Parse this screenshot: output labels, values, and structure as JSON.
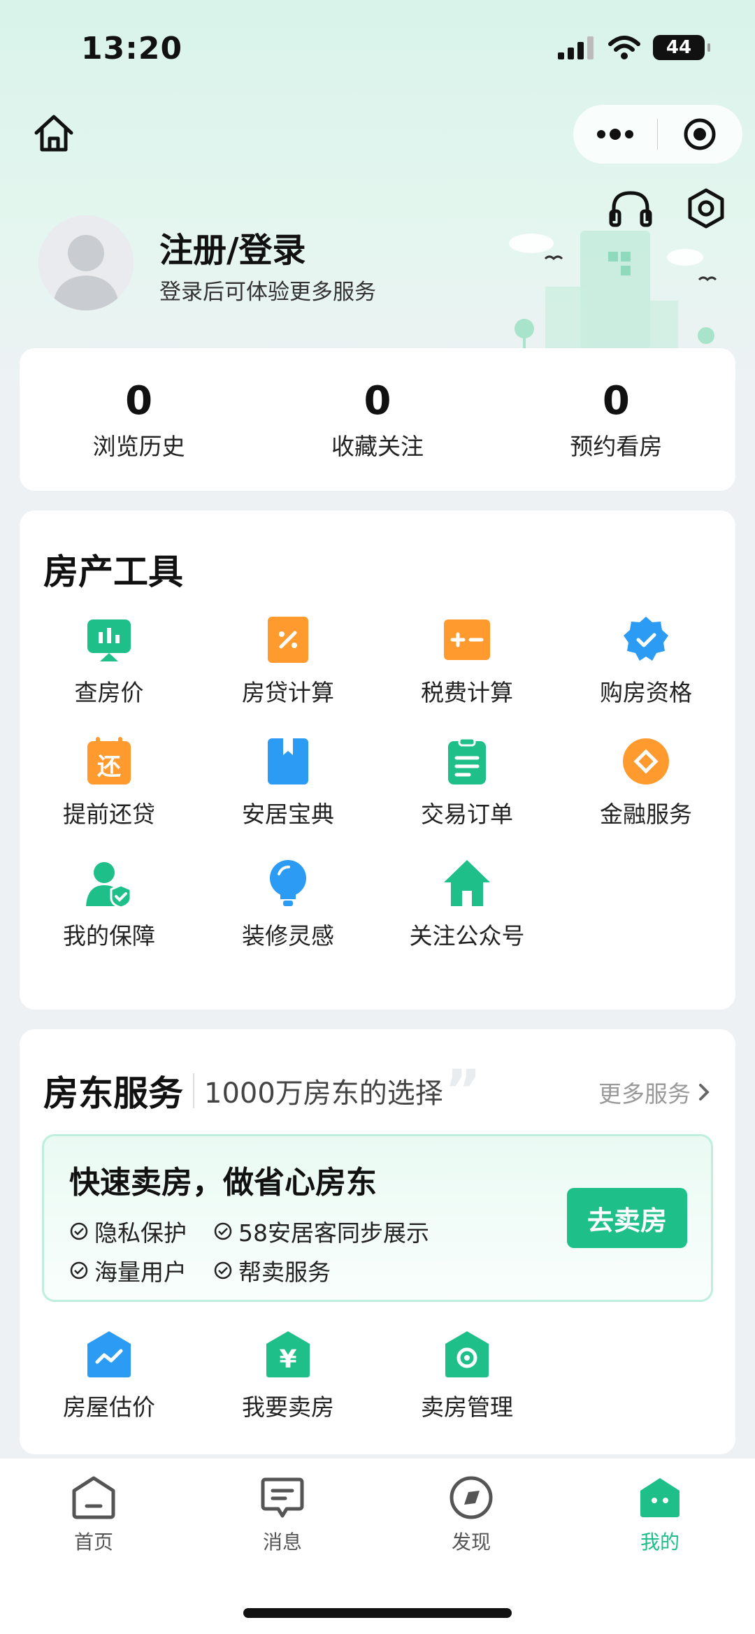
{
  "status_bar": {
    "time": "13:20",
    "battery": "44"
  },
  "profile": {
    "title": "注册/登录",
    "subtitle": "登录后可体验更多服务"
  },
  "stats": [
    {
      "value": "0",
      "label": "浏览历史"
    },
    {
      "value": "0",
      "label": "收藏关注"
    },
    {
      "value": "0",
      "label": "预约看房"
    }
  ],
  "tools": {
    "title": "房产工具",
    "items": [
      {
        "label": "查房价",
        "icon": "house-price-icon"
      },
      {
        "label": "房贷计算",
        "icon": "mortgage-calc-icon"
      },
      {
        "label": "税费计算",
        "icon": "tax-calc-icon"
      },
      {
        "label": "购房资格",
        "icon": "qualification-icon"
      },
      {
        "label": "提前还贷",
        "icon": "early-repay-icon"
      },
      {
        "label": "安居宝典",
        "icon": "guide-book-icon"
      },
      {
        "label": "交易订单",
        "icon": "order-icon"
      },
      {
        "label": "金融服务",
        "icon": "finance-icon"
      },
      {
        "label": "我的保障",
        "icon": "protection-icon"
      },
      {
        "label": "装修灵感",
        "icon": "bulb-icon"
      },
      {
        "label": "关注公众号",
        "icon": "official-account-icon"
      }
    ]
  },
  "landlord": {
    "title": "房东服务",
    "subtitle": "1000万房东的选择",
    "more": "更多服务",
    "promo": {
      "title": "快速卖房，做省心房东",
      "features": [
        "隐私保护",
        "58安居客同步展示",
        "海量用户",
        "帮卖服务"
      ],
      "button": "去卖房"
    },
    "items": [
      {
        "label": "房屋估价",
        "icon": "valuation-icon"
      },
      {
        "label": "我要卖房",
        "icon": "sell-house-icon"
      },
      {
        "label": "卖房管理",
        "icon": "sell-manage-icon"
      }
    ]
  },
  "tabbar": [
    {
      "label": "首页",
      "icon": "home-tab-icon"
    },
    {
      "label": "消息",
      "icon": "message-tab-icon"
    },
    {
      "label": "发现",
      "icon": "discover-tab-icon"
    },
    {
      "label": "我的",
      "icon": "me-tab-icon",
      "active": true
    }
  ],
  "colors": {
    "accent": "#1fbf8a",
    "orange": "#ff9a2e",
    "blue": "#2b9bf4"
  }
}
